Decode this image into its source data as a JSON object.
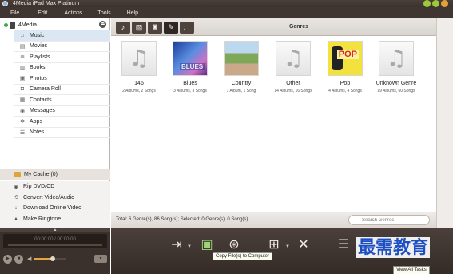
{
  "window": {
    "title": "4Media iPad Max Platinum"
  },
  "menubar": {
    "items": [
      "File",
      "Edit",
      "Actions",
      "Tools",
      "Help"
    ]
  },
  "sidebar": {
    "device_name": "4Media",
    "items": [
      {
        "label": "Music",
        "icon": "music-icon",
        "active": true
      },
      {
        "label": "Movies",
        "icon": "film-icon"
      },
      {
        "label": "Playlists",
        "icon": "playlist-icon"
      },
      {
        "label": "Books",
        "icon": "book-icon"
      },
      {
        "label": "Photos",
        "icon": "photo-icon"
      },
      {
        "label": "Camera Roll",
        "icon": "camera-icon"
      },
      {
        "label": "Contacts",
        "icon": "contacts-icon"
      },
      {
        "label": "Messages",
        "icon": "message-icon"
      },
      {
        "label": "Apps",
        "icon": "apps-icon"
      },
      {
        "label": "Notes",
        "icon": "notes-icon"
      }
    ],
    "cache": "My Cache (0)",
    "tasks": [
      {
        "label": "Rip DVD/CD",
        "icon": "disc-icon"
      },
      {
        "label": "Convert Video/Audio",
        "icon": "convert-icon"
      },
      {
        "label": "Download Online Video",
        "icon": "download-icon"
      },
      {
        "label": "Make Ringtone",
        "icon": "bell-icon"
      }
    ]
  },
  "player": {
    "time": "00:00:00 / 00:00:00",
    "volume": 0.6
  },
  "main": {
    "section_title": "Genres",
    "tabs": [
      "music-note-tab",
      "album-tab",
      "artist-tab",
      "genre-tab",
      "composer-tab"
    ],
    "genres": [
      {
        "name": "146",
        "stats": "2 Albums, 2 Songs",
        "cover": "default"
      },
      {
        "name": "Blues",
        "stats": "3 Albums, 3 Songs",
        "cover": "blues",
        "cover_text": "BLUES"
      },
      {
        "name": "Country",
        "stats": "1 Album, 1 Song",
        "cover": "country"
      },
      {
        "name": "Other",
        "stats": "14 Albums, 16 Songs",
        "cover": "default"
      },
      {
        "name": "Pop",
        "stats": "4 Albums, 4 Songs",
        "cover": "pop",
        "cover_text": "POP"
      },
      {
        "name": "Unknown Genre",
        "stats": "19 Albums, 60 Songs",
        "cover": "default"
      }
    ],
    "status": "Total: 6 Genre(s), 86 Song(s); Selected: 0 Genre(s), 0 Song(s)",
    "search_placeholder": "Search Genres"
  },
  "actions": {
    "tooltip": "Copy File(s) to Computer",
    "view_all": "View All Tasks",
    "watermark": "最需教育"
  }
}
